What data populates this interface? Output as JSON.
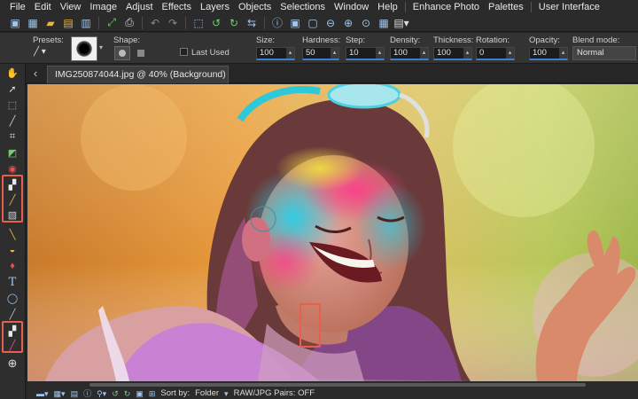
{
  "menu": {
    "items": [
      "File",
      "Edit",
      "View",
      "Image",
      "Adjust",
      "Effects",
      "Layers",
      "Objects",
      "Selections",
      "Window",
      "Help",
      "Enhance Photo",
      "Palettes",
      "User Interface"
    ]
  },
  "options": {
    "presets_label": "Presets:",
    "shape_label": "Shape:",
    "last_used_label": "Last Used",
    "size_label": "Size:",
    "size_value": "100",
    "hardness_label": "Hardness:",
    "hardness_value": "50",
    "step_label": "Step:",
    "step_value": "10",
    "density_label": "Density:",
    "density_value": "100",
    "thickness_label": "Thickness:",
    "thickness_value": "100",
    "rotation_label": "Rotation:",
    "rotation_value": "0",
    "opacity_label": "Opacity:",
    "opacity_value": "100",
    "blend_label": "Blend mode:",
    "blend_value": "Normal"
  },
  "document": {
    "tab_title": "IMG250874044.jpg @  40% (Background)"
  },
  "bottombar": {
    "sort_label": "Sort by:",
    "sort_value": "Folder",
    "raw_label": "RAW/JPG Pairs: OFF"
  },
  "colors": {
    "highlight": "#e8604c",
    "accent": "#3a7fd0"
  }
}
